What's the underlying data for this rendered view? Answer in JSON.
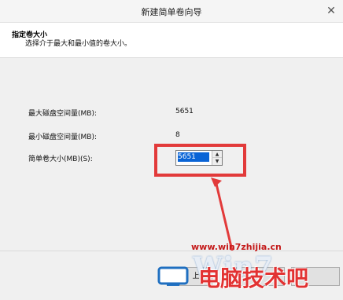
{
  "window": {
    "title": "新建简单卷向导",
    "close_glyph": "✕"
  },
  "header": {
    "title": "指定卷大小",
    "subtitle": "选择介于最大和最小值的卷大小。"
  },
  "fields": {
    "max_label": "最大磁盘空间量(MB):",
    "max_value": "5651",
    "min_label": "最小磁盘空间量(MB):",
    "min_value": "8",
    "size_label": "简单卷大小(MB)(S):",
    "size_value": "5651"
  },
  "footer": {
    "button_partial_label": "上"
  },
  "watermark": {
    "url": "www.win7zhijia.cn",
    "logo": "Win7",
    "cn_text": "电脑技术吧"
  },
  "colors": {
    "highlight": "#e23a3a",
    "watermark_red": "#c41a1a",
    "selection": "#0a64d6"
  },
  "icons": [
    "close-icon",
    "spin-up-icon",
    "spin-down-icon",
    "tv-logo-icon",
    "red-arrow"
  ]
}
